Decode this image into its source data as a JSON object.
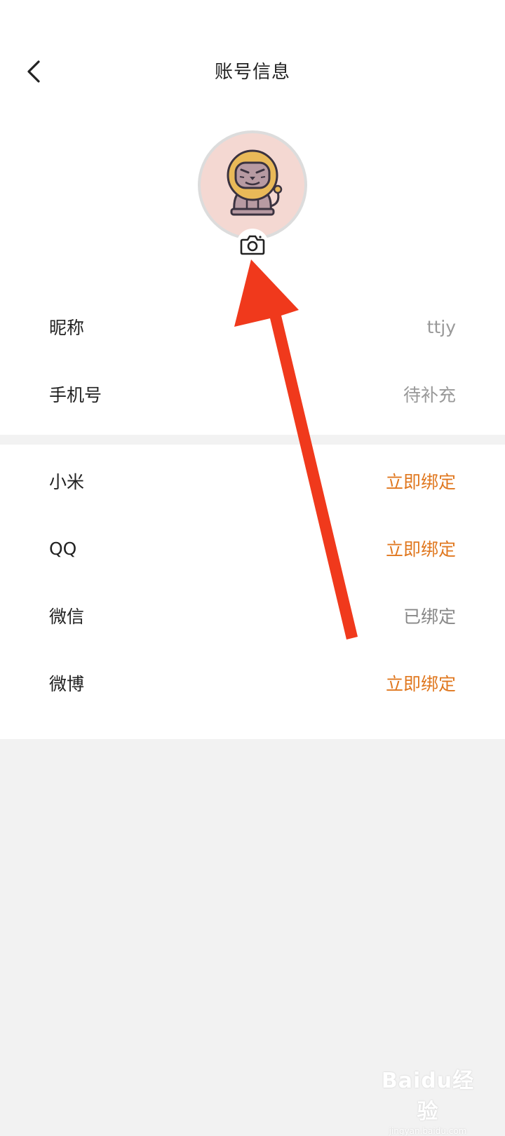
{
  "header": {
    "title": "账号信息",
    "back_icon": "chevron-left-icon"
  },
  "avatar": {
    "image": "lion-avatar",
    "camera_icon": "camera-icon",
    "bg_color": "#f4d8d2"
  },
  "profile_rows": [
    {
      "label": "昵称",
      "value": "ttjy"
    },
    {
      "label": "手机号",
      "value": "待补充"
    }
  ],
  "binding_rows": [
    {
      "label": "小米",
      "value": "立即绑定",
      "state": "unbound"
    },
    {
      "label": "QQ",
      "value": "立即绑定",
      "state": "unbound"
    },
    {
      "label": "微信",
      "value": "已绑定",
      "state": "bound"
    },
    {
      "label": "微博",
      "value": "立即绑定",
      "state": "unbound"
    }
  ],
  "colors": {
    "accent": "#e07820",
    "annotation_arrow": "#f0391c",
    "page_bg": "#f2f2f2"
  },
  "watermark": {
    "logo_text": "Baidu经验",
    "sub_text": "jingyan.baidu.com"
  }
}
